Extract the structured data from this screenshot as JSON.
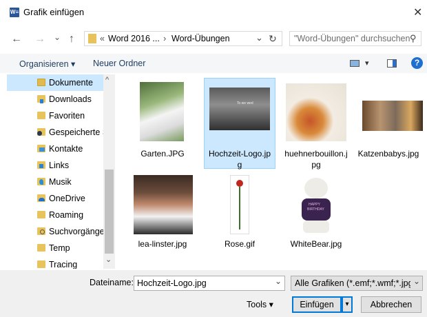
{
  "window": {
    "title": "Grafik einfügen",
    "app_icon": "W≡",
    "close_glyph": "✕"
  },
  "nav": {
    "back_glyph": "←",
    "forward_glyph": "→",
    "recent_glyph": "⌄",
    "up_glyph": "↑",
    "breadcrumb_overflow": "«",
    "crumb1": "Word 2016 ...",
    "sep": "›",
    "crumb2": "Word-Übungen",
    "dropdown_glyph": "⌄",
    "refresh_glyph": "↻",
    "search_placeholder": "\"Word-Übungen\" durchsuchen",
    "search_glyph": "⚲"
  },
  "toolbar": {
    "organize": "Organisieren ▾",
    "new_folder": "Neuer Ordner",
    "view_glyph": "▾",
    "help_glyph": "?"
  },
  "sidebar": {
    "scroll_up": "^",
    "scroll_down": "⌄",
    "items": [
      {
        "label": "Dokumente",
        "color": "#e0b94f"
      },
      {
        "label": "Downloads",
        "color": "#2a7fd4"
      },
      {
        "label": "Favoriten",
        "color": "#e8c35c"
      },
      {
        "label": "Gespeicherte S",
        "color": "#3a7fc1"
      },
      {
        "label": "Kontakte",
        "color": "#3c8fd8"
      },
      {
        "label": "Links",
        "color": "#2d82d2"
      },
      {
        "label": "Musik",
        "color": "#2b8fd6"
      },
      {
        "label": "OneDrive",
        "color": "#1e6fd0"
      },
      {
        "label": "Roaming",
        "color": "#e8c35c"
      },
      {
        "label": "Suchvorgänge",
        "color": "#e8c35c"
      },
      {
        "label": "Temp",
        "color": "#e8c35c"
      },
      {
        "label": "Tracing",
        "color": "#e8c35c"
      }
    ]
  },
  "files": [
    {
      "name": "GartenJPG",
      "line1": "Garten.JPG",
      "line2": ""
    },
    {
      "name": "Hochzeit-Logo",
      "line1": "Hochzeit-Logo.jp",
      "line2": "g",
      "caption": "To we wed"
    },
    {
      "name": "huehnerbouillon",
      "line1": "huehnerbouillon.j",
      "line2": "pg"
    },
    {
      "name": "Katzenbabys",
      "line1": "Katzenbabys.jpg",
      "line2": ""
    },
    {
      "name": "lea-linster",
      "line1": "lea-linster.jpg",
      "line2": ""
    },
    {
      "name": "Rose",
      "line1": "Rose.gif",
      "line2": ""
    },
    {
      "name": "WhiteBear",
      "line1": "WhiteBear.jpg",
      "line2": "",
      "shirt_text1": "HAPPY",
      "shirt_text2": "BIRTHDAY"
    }
  ],
  "footer": {
    "filename_label": "Dateiname:",
    "filename_value": "Hochzeit-Logo.jpg",
    "filename_drop": "⌄",
    "filter_value": "Alle Grafiken (*.emf;*.wmf;*.jpg;",
    "filter_drop": "⌄",
    "tools_label": "Tools ▾",
    "insert_label": "Einfügen",
    "insert_drop": "▾",
    "cancel_label": "Abbrechen"
  }
}
